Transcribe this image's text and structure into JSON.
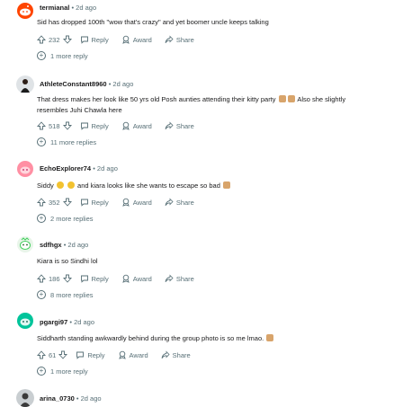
{
  "comments": [
    {
      "username": "termianal",
      "time": "2d ago",
      "text": "Sid has dropped 100th \"wow that's crazy\" and yet boomer uncle keeps talking",
      "votes": "232",
      "reply": "Reply",
      "award": "Award",
      "share": "Share",
      "more": "1 more reply",
      "avatar_color": "#ff4500"
    },
    {
      "username": "AthleteConstant8960",
      "time": "2d ago",
      "text": "That dress makes her look like 50 yrs old Posh aunties attending their kitty party",
      "text2": "Also she slightly",
      "text3": "resembles Juhi Chawla here",
      "votes": "518",
      "reply": "Reply",
      "award": "Award",
      "share": "Share",
      "more": "11 more replies",
      "avatar_color": "#1c1c1c"
    },
    {
      "username": "EchoExplorer74",
      "time": "2d ago",
      "text_a": "Siddy",
      "text_b": "and kiara looks like she wants to escape so bad",
      "votes": "352",
      "reply": "Reply",
      "award": "Award",
      "share": "Share",
      "more": "2 more replies",
      "avatar_color": "#ff8fa3"
    },
    {
      "username": "sdfhgx",
      "time": "2d ago",
      "text": "Kiara is so Sindhi lol",
      "votes": "186",
      "reply": "Reply",
      "award": "Award",
      "share": "Share",
      "more": "8 more replies",
      "avatar_color": "#46d160"
    },
    {
      "username": "pgargi97",
      "time": "2d ago",
      "text": "Siddharth standing awkwardly behind during the group photo is so me lmao.",
      "votes": "61",
      "reply": "Reply",
      "award": "Award",
      "share": "Share",
      "more": "1 more reply",
      "avatar_color": "#00c49a"
    },
    {
      "username": "arina_0730",
      "time": "2d ago",
      "avatar_color": "#3a3a3a"
    }
  ]
}
